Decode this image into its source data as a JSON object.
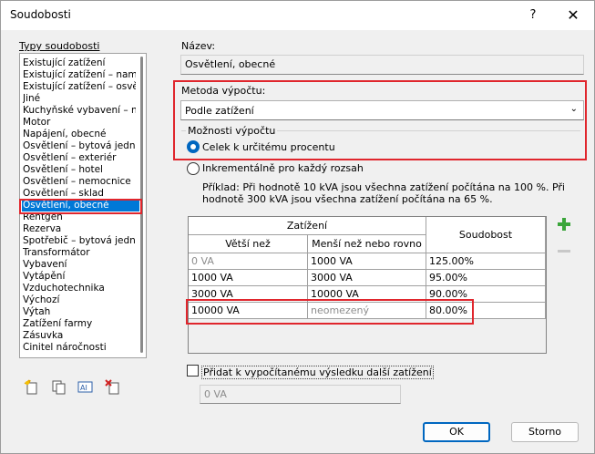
{
  "window": {
    "title": "Soudobosti",
    "help_glyph": "?",
    "close_glyph": "✕"
  },
  "left": {
    "group_label": "Typy soudobosti",
    "items": [
      "Existující zatížení",
      "Existující zatížení – naměř",
      "Existující zatížení – osvětle",
      "Jiné",
      "Kuchyňské vybavení – neb",
      "Motor",
      "Napájení, obecné",
      "Osvětlení – bytová jednotk",
      "Osvětlení – exteriér",
      "Osvětlení – hotel",
      "Osvětlení – nemocnice",
      "Osvětlení – sklad",
      "Osvětlení, obecné",
      "Rentgen",
      "Rezerva",
      "Spotřebič – bytová jednotk",
      "Transformátor",
      "Vybavení",
      "Vytápění",
      "Vzduchotechnika",
      "Výchozí",
      "Výtah",
      "Zatížení farmy",
      "Zásuvka",
      "Činitel náročnosti"
    ],
    "selected_index": 12,
    "toolbar_icons": [
      "new-type-icon",
      "duplicate-icon",
      "rename-icon",
      "delete-icon"
    ]
  },
  "right": {
    "name_label": "Název:",
    "name_value": "Osvětlení, obecné",
    "method_label": "Metoda výpočtu:",
    "method_value": "Podle zatížení",
    "options_label": "Možnosti výpočtu",
    "radio_percent": "Celek k určitému procentu",
    "radio_incremental": "Inkrementálně pro každý rozsah",
    "example_line1": "Příklad: Při hodnotě 10 kVA jsou všechna zatížení počítána na 100 %. Při",
    "example_line2": "hodnotě 300 kVA jsou všechna zatížení počítána na 65 %.",
    "table": {
      "header_group": "Zatížení",
      "col_gt": "Větší než",
      "col_lt": "Menší než nebo rovno",
      "col_factor": "Soudobost",
      "rows": [
        {
          "gt": "0 VA",
          "lt": "1000 VA",
          "factor": "125.00%"
        },
        {
          "gt": "1000 VA",
          "lt": "3000 VA",
          "factor": "95.00%"
        },
        {
          "gt": "3000 VA",
          "lt": "10000 VA",
          "factor": "90.00%"
        },
        {
          "gt": "10000 VA",
          "lt": "neomezený",
          "factor": "80.00%"
        }
      ]
    },
    "add_checkbox_label": "Přidat k vypočítanému výsledku další zatížení",
    "add_value": "0 VA"
  },
  "buttons": {
    "ok": "OK",
    "cancel": "Storno"
  },
  "colors": {
    "accent": "#0067c0",
    "highlight": "#e0262d",
    "selection": "#0078d7"
  }
}
